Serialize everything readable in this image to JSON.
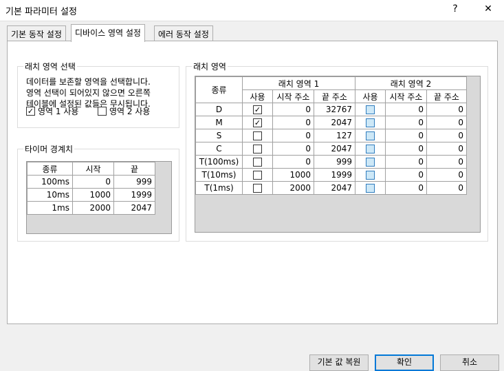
{
  "window": {
    "title": "기본 파라미터 설정",
    "help_glyph": "?",
    "close_glyph": "✕"
  },
  "tabs": [
    {
      "label": "기본 동작 설정"
    },
    {
      "label": "디바이스 영역 설정"
    },
    {
      "label": "에러 동작 설정"
    }
  ],
  "latch_select": {
    "title": "래치 영역 선택",
    "desc": [
      "데이터를 보존할 영역을 선택합니다.",
      "영역 선택이 되어있지 않으면 오른쪽",
      "테이블에 설정된 값들은 무시됩니다."
    ],
    "area1": {
      "label": "영역 1 사용",
      "checked": true
    },
    "area2": {
      "label": "영역 2 사용",
      "checked": false
    }
  },
  "timer": {
    "title": "타이머 경계치",
    "headers": [
      "종류",
      "시작",
      "끝"
    ],
    "rows": [
      {
        "type": "100ms",
        "start": "0",
        "end": "999"
      },
      {
        "type": "10ms",
        "start": "1000",
        "end": "1999"
      },
      {
        "type": "1ms",
        "start": "2000",
        "end": "2047"
      }
    ]
  },
  "latch": {
    "title": "래치 영역",
    "type_header": "종류",
    "group1": "래치 영역 1",
    "group2": "래치 영역 2",
    "sub_headers": [
      "사용",
      "시작 주소",
      "끝 주소"
    ],
    "rows": [
      {
        "type": "D",
        "use1": true,
        "start1": "0",
        "end1": "32767",
        "use2": false,
        "start2": "0",
        "end2": "0"
      },
      {
        "type": "M",
        "use1": true,
        "start1": "0",
        "end1": "2047",
        "use2": false,
        "start2": "0",
        "end2": "0"
      },
      {
        "type": "S",
        "use1": false,
        "start1": "0",
        "end1": "127",
        "use2": false,
        "start2": "0",
        "end2": "0"
      },
      {
        "type": "C",
        "use1": false,
        "start1": "0",
        "end1": "2047",
        "use2": false,
        "start2": "0",
        "end2": "0"
      },
      {
        "type": "T(100ms)",
        "use1": false,
        "start1": "0",
        "end1": "999",
        "use2": false,
        "start2": "0",
        "end2": "0"
      },
      {
        "type": "T(10ms)",
        "use1": false,
        "start1": "1000",
        "end1": "1999",
        "use2": false,
        "start2": "0",
        "end2": "0"
      },
      {
        "type": "T(1ms)",
        "use1": false,
        "start1": "2000",
        "end1": "2047",
        "use2": false,
        "start2": "0",
        "end2": "0"
      }
    ]
  },
  "buttons": {
    "restore": "기본 값 복원",
    "ok": "확인",
    "cancel": "취소"
  }
}
